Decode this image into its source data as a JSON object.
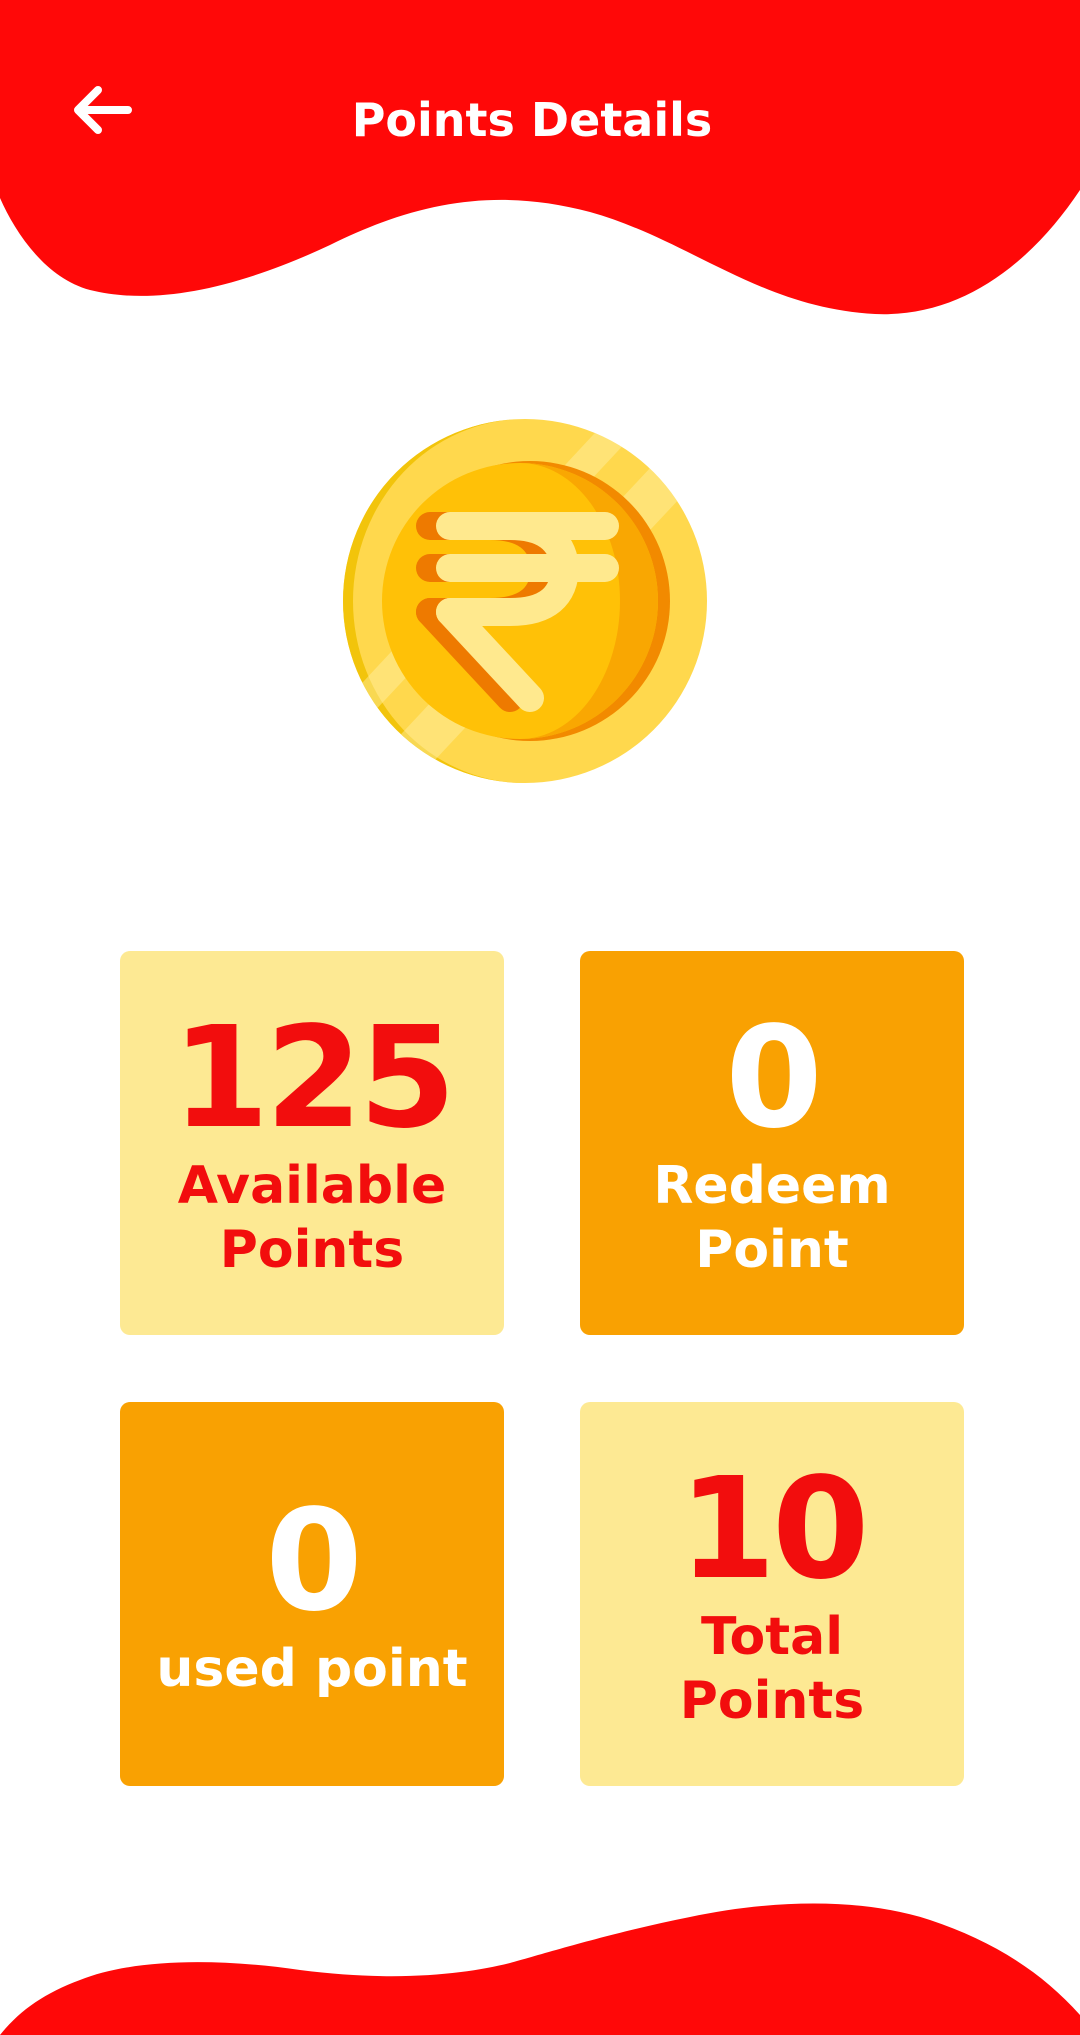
{
  "header": {
    "title": "Points Details"
  },
  "colors": {
    "header_red": "#ff0808",
    "card_light": "#fde993",
    "card_dark": "#f9a102",
    "text_red": "#f20d0d",
    "coin_gold": "#ffd84d"
  },
  "icons": {
    "back": "arrow-left-icon",
    "coin": "rupee-coin-icon"
  },
  "cards": [
    {
      "value": "125",
      "label": "Available Points"
    },
    {
      "value": "0",
      "label": "Redeem Point"
    },
    {
      "value": "0",
      "label": "used point"
    },
    {
      "value": "10",
      "label": "Total Points"
    }
  ]
}
